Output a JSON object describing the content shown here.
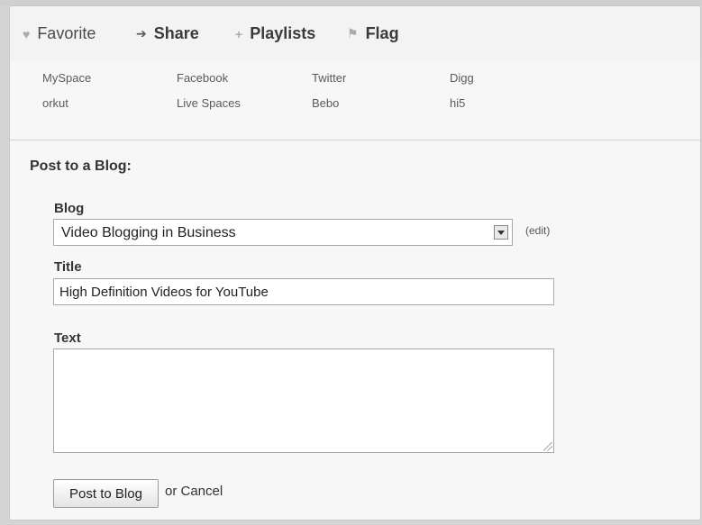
{
  "tabs": [
    {
      "label": "Favorite",
      "icon": "heart-icon"
    },
    {
      "label": "Share",
      "icon": "share-arrow-icon"
    },
    {
      "label": "Playlists",
      "icon": "plus-icon"
    },
    {
      "label": "Flag",
      "icon": "flag-icon"
    }
  ],
  "share_links": [
    "MySpace",
    "Facebook",
    "Twitter",
    "Digg",
    "orkut",
    "Live Spaces",
    "Bebo",
    "hi5"
  ],
  "post_form": {
    "heading": "Post to a Blog:",
    "blog_label": "Blog",
    "blog_selected": "Video Blogging in Business",
    "edit_label": "(edit)",
    "title_label": "Title",
    "title_value": "High Definition Videos for YouTube",
    "text_label": "Text",
    "text_value": "",
    "submit_label": "Post to Blog",
    "cancel_label": "or Cancel"
  }
}
